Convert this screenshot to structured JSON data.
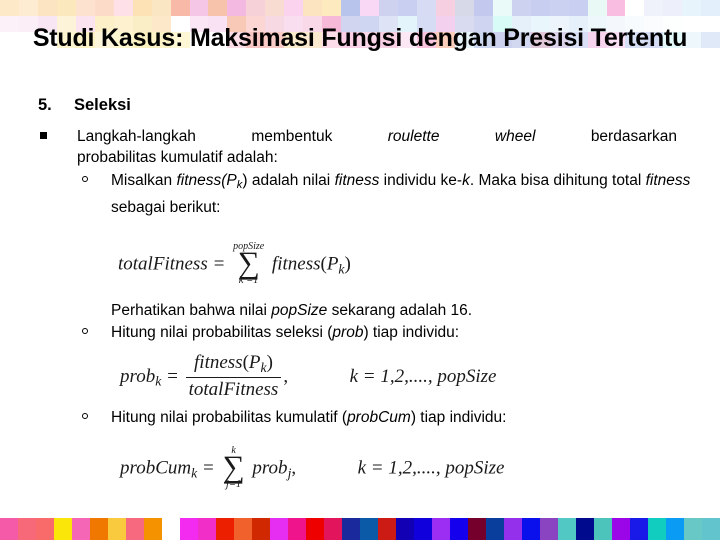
{
  "slide": {
    "title": "Studi Kasus: Maksimasi Fungsi dengan Presisi Tertentu",
    "numbered_marker": "5.",
    "numbered_label": "Seleksi",
    "bullet_line_1": "Langkah-langkah membentuk roulette wheel berdasarkan",
    "bullet_line_1_part_a": "Langkah-langkah",
    "bullet_line_1_part_b": "membentuk",
    "bullet_line_1_part_c": "roulette",
    "bullet_line_1_part_d": "wheel",
    "bullet_line_1_part_e": "berdasarkan",
    "bullet_line_2": "probabilitas kumulatif adalah:",
    "sub_bullet_1": "Misalkan fitness(Pk) adalah nilai fitness individu ke-k. Maka bisa dihitung total fitness sebagai berikut:",
    "sub_bullet_1_a": "Misalkan ",
    "sub_bullet_1_b": "fitness(P",
    "sub_bullet_1_k": "k",
    "sub_bullet_1_c": ") adalah nilai ",
    "sub_bullet_1_d": "fitness",
    "sub_bullet_1_e": " individu ke-",
    "sub_bullet_1_f": "k",
    "sub_bullet_1_g": ". Maka bisa dihitung total ",
    "sub_bullet_1_h": "fitness",
    "sub_bullet_1_i": " sebagai berikut:",
    "note_line_a": "Perhatikan bahwa nilai ",
    "note_line_b": "popSize",
    "note_line_c": " sekarang adalah 16.",
    "pop_size_value": "16",
    "sub_bullet_2_a": "Hitung nilai probabilitas seleksi (",
    "sub_bullet_2_b": "prob",
    "sub_bullet_2_c": ") tiap individu:",
    "sub_bullet_3_a": "Hitung nilai probabilitas kumulatif (",
    "sub_bullet_3_b": "probCum",
    "sub_bullet_3_c": ") tiap individu:"
  },
  "equations": {
    "eq1": {
      "lhs": "totalFitness",
      "equals": "=",
      "sigma_top": "popSize",
      "sigma_glyph": "∑",
      "sigma_bottom": "k =1",
      "body": "fitness",
      "open": "(",
      "arg": "P",
      "arg_sub": "k",
      "close": ")"
    },
    "eq2": {
      "lhs": "prob",
      "lhs_sub": "k",
      "equals": "=",
      "num": "fitness",
      "num_open": "(",
      "num_arg": "P",
      "num_arg_sub": "k",
      "num_close": ")",
      "den": "totalFitness",
      "comma": ",",
      "range": "k = 1,2,...., popSize"
    },
    "eq3": {
      "lhs": "probCum",
      "lhs_sub": "k",
      "equals": "=",
      "sigma_top": "k",
      "sigma_glyph": "∑",
      "sigma_bottom": "j=1",
      "body": "prob",
      "body_sub": "j",
      "comma": ",",
      "range": "k = 1,2,...., popSize"
    }
  },
  "decor": {
    "top_band_rows": [
      [
        "#fde8c8",
        "#fdecd2",
        "#fce4c2",
        "#fbe9bd",
        "#fde3cf",
        "#fcdcc9",
        "#fde0e8",
        "#fce2b4",
        "#fbe6c3",
        "#f9b9a8",
        "#f6c6e6",
        "#f8c3ab",
        "#f4b9e0",
        "#f6d2d8",
        "#f8dcd2",
        "#fbd3ee",
        "#fde4c0",
        "#fdebbf",
        "#b9c4ec",
        "#f8d8f4",
        "#cfd2ee",
        "#c9cff0",
        "#d8dbf4",
        "#f6cfe0",
        "#d7d9e8",
        "#c3c8ef",
        "#eafaf8",
        "#cdd2f1",
        "#c8cef0",
        "#cbd1f0",
        "#c9cff0",
        "#e8f9f6",
        "#f9bde2",
        "#ffffff",
        "#f0f2fb",
        "#edf0fa",
        "#e8f4fb",
        "#e3effa"
      ],
      [
        "#fcf0f9",
        "#fbeef7",
        "#f9e6f5",
        "#fdf3d9",
        "#fbe4f0",
        "#fdf0c9",
        "#fdf1cf",
        "#faeec6",
        "#fde9c9",
        "#ffffff",
        "#fbe6f6",
        "#fae2f5",
        "#f9c9b8",
        "#fbd6d2",
        "#f6d9e2",
        "#f9def0",
        "#f9d8e8",
        "#f7b9d8",
        "#d2d5ef",
        "#cfd6f2",
        "#dfe3f6",
        "#e3f4fa",
        "#d6dcf3",
        "#f3d0ee",
        "#d9dcf1",
        "#cfd4f1",
        "#d8fbf8",
        "#e5f0fb",
        "#e9f6fc",
        "#eef4fb",
        "#e6f0fa",
        "#eef8fc",
        "#f4f8fd",
        "#f7fbfe",
        "#fafcfe",
        "#fdfefe",
        "#ffffff",
        "#ffffff"
      ],
      [
        "#ffffff",
        "#ffffff",
        "#ffffff",
        "#fdf4d0",
        "#fdf2c6",
        "#fcf5d9",
        "#fdf6cf",
        "#fbf0c0",
        "#fcf2c6",
        "#fdf7d6",
        "#ffffff",
        "#ffffff",
        "#f9dce6",
        "#f7c6c3",
        "#f8cbc6",
        "#fbeccd",
        "#fbe9cf",
        "#fbdce8",
        "#fbd0e6",
        "#fad6e9",
        "#f9cfe3",
        "#fce8f4",
        "#f9c4dd",
        "#f9cdb9",
        "#e6f4fa",
        "#ccd6ee",
        "#ccd2ee",
        "#d2d8f0",
        "#e2c9d9",
        "#dcd4ea",
        "#d9dff4",
        "#f6d4ee",
        "#f9e0f4",
        "#d6dff3",
        "#d3dcf2",
        "#e3f9fa",
        "#edf7fc",
        "#dfe9f8"
      ]
    ],
    "footer_colors": [
      "#f45aa8",
      "#f76878",
      "#f96a6a",
      "#fbe60a",
      "#f566b6",
      "#f07800",
      "#f9c93e",
      "#f7697f",
      "#f59200",
      "#ffffff",
      "#f32af0",
      "#f22ec8",
      "#ec2000",
      "#f1612c",
      "#d02800",
      "#e62ef2",
      "#f0148c",
      "#ef0000",
      "#e2145c",
      "#1a2a9c",
      "#0a5aa8",
      "#cc1a14",
      "#1200b4",
      "#1000dc",
      "#9b2ef2",
      "#1400ec",
      "#76002c",
      "#0a3e9c",
      "#9430ec",
      "#0a10ec",
      "#8a44c2",
      "#52c8c4",
      "#000a8c",
      "#4cc4bc",
      "#9a06e8",
      "#1a1ae8",
      "#10cdc0",
      "#0a9cf4",
      "#68c8c6",
      "#62c4cc"
    ]
  }
}
